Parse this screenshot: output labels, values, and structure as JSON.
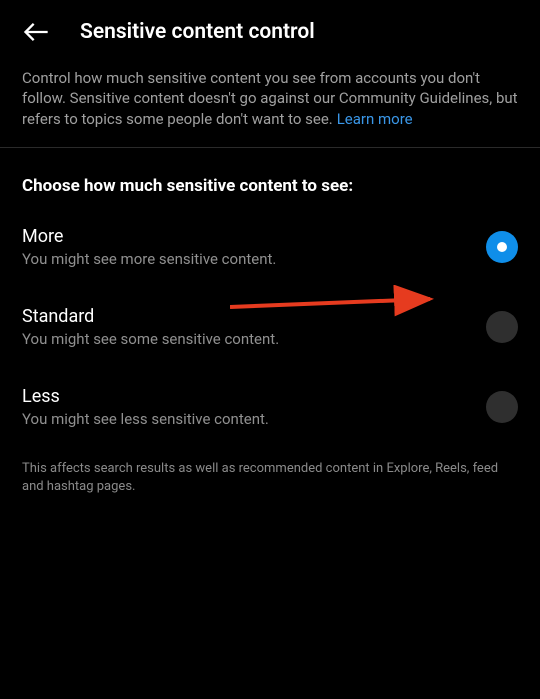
{
  "header": {
    "title": "Sensitive content control"
  },
  "description": {
    "text": "Control how much sensitive content you see from accounts you don't follow. Sensitive content doesn't go against our Community Guidelines, but refers to topics some people don't want to see.",
    "learn_more": "Learn more"
  },
  "section": {
    "heading": "Choose how much sensitive content to see:"
  },
  "options": [
    {
      "title": "More",
      "desc": "You might see more sensitive content.",
      "selected": true
    },
    {
      "title": "Standard",
      "desc": "You might see some sensitive content.",
      "selected": false
    },
    {
      "title": "Less",
      "desc": "You might see less sensitive content.",
      "selected": false
    }
  ],
  "footnote": "This affects search results as well as recommended content in Explore, Reels, feed and hashtag pages.",
  "annotation": {
    "arrow_color": "#e63b1f"
  }
}
